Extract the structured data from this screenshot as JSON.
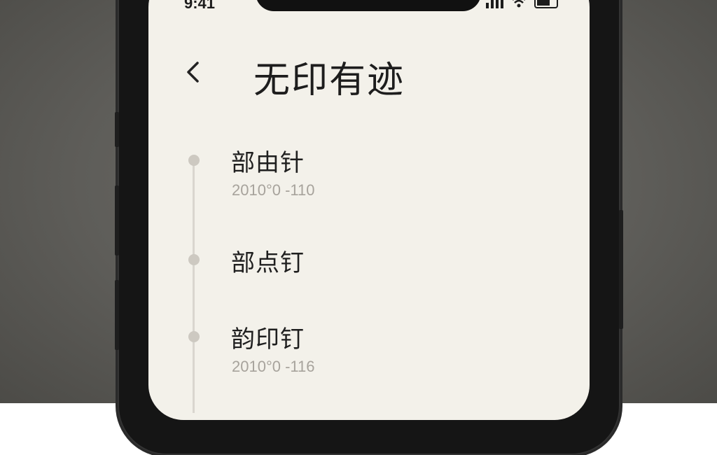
{
  "status_bar": {
    "time": "9:41"
  },
  "header": {
    "title": "无印有迹"
  },
  "timeline": {
    "items": [
      {
        "title": "部由针",
        "date": "2010°0 -110"
      },
      {
        "title": "部点钉",
        "date": ""
      },
      {
        "title": "韵印钉",
        "date": "2010°0 -116"
      }
    ]
  },
  "colors": {
    "screen_bg": "#f3f1ea",
    "text": "#1d1d1d",
    "muted": "#a7a39c",
    "timeline": "#cdc9c1"
  },
  "icons": [
    "back-icon",
    "signal-icon",
    "wifi-icon",
    "battery-icon"
  ]
}
